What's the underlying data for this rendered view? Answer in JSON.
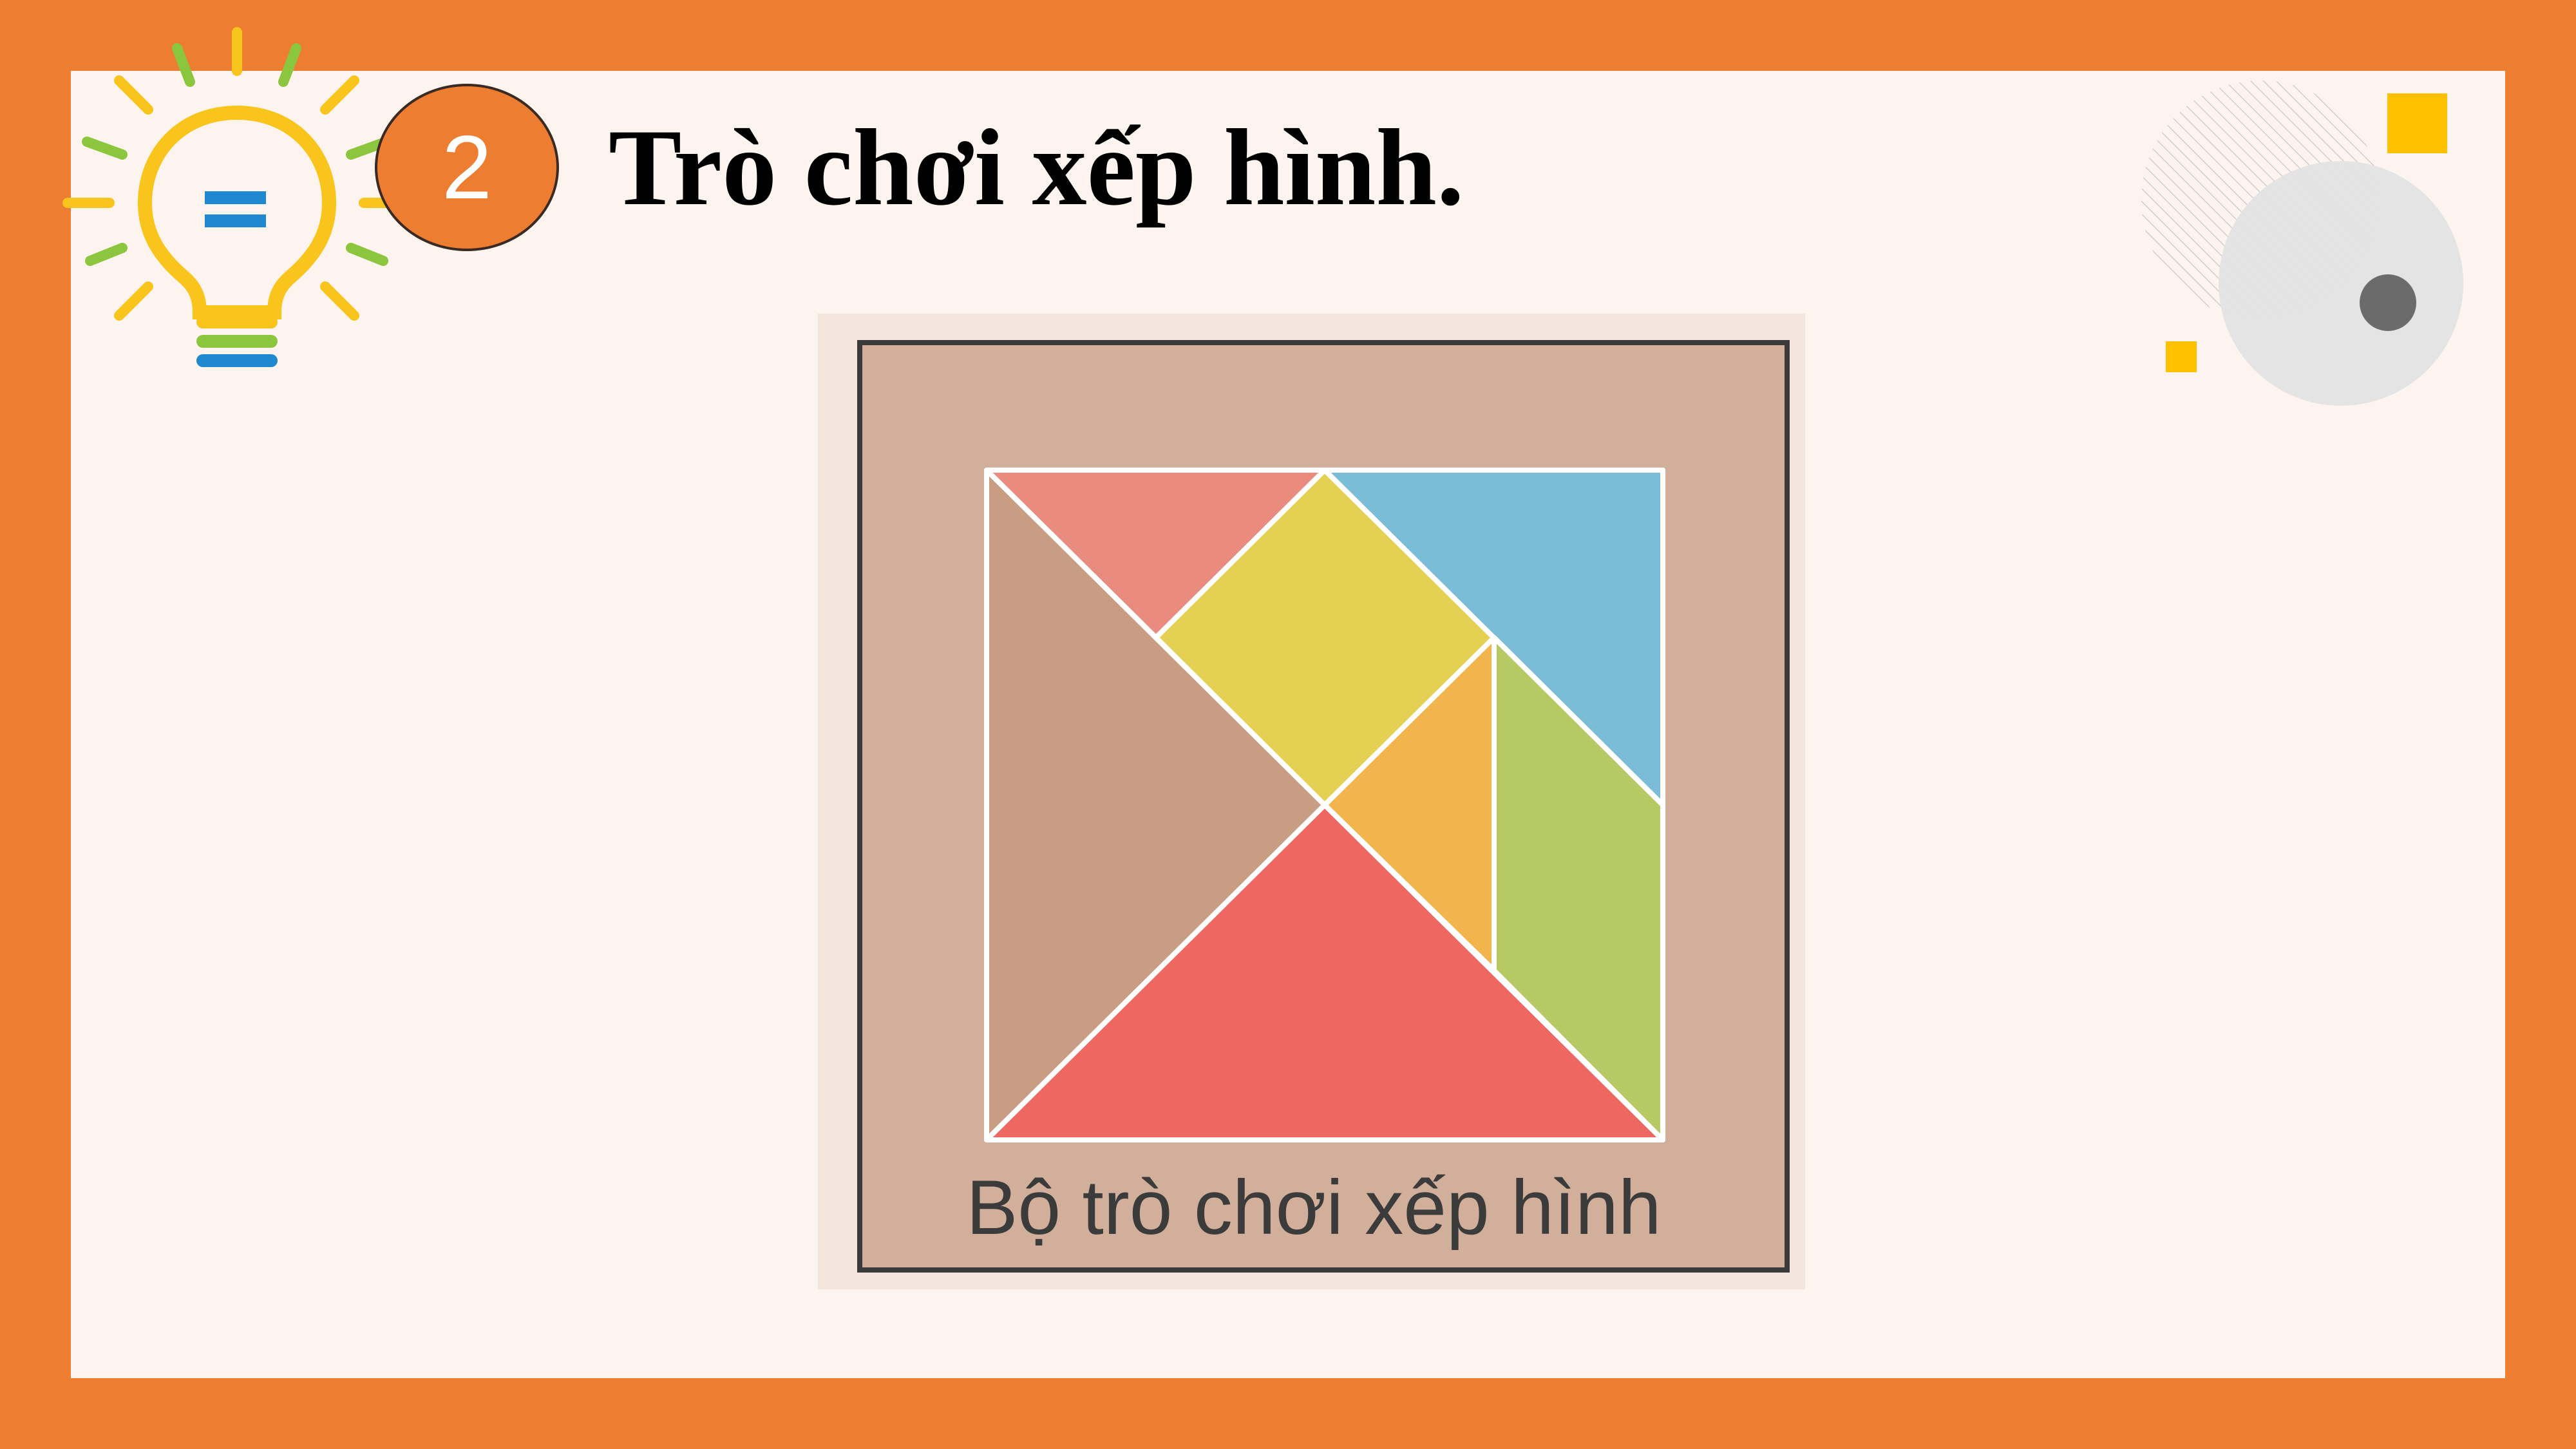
{
  "slide": {
    "number": "2",
    "title": "Trò chơi xếp hình."
  },
  "figure": {
    "caption": "Bộ trò chơi xếp hình",
    "pieces": [
      {
        "name": "small-pink-triangle",
        "color": "#E98B7E"
      },
      {
        "name": "yellow-square",
        "color": "#E4D052"
      },
      {
        "name": "blue-triangle",
        "color": "#7BBCD6"
      },
      {
        "name": "brown-triangle",
        "color": "#C99C84"
      },
      {
        "name": "orange-triangle",
        "color": "#F2B54E"
      },
      {
        "name": "green-parallelogram",
        "color": "#B6C965"
      },
      {
        "name": "red-triangle",
        "color": "#EE6761"
      }
    ]
  },
  "colors": {
    "frame": "#ED7D31",
    "background": "#FDF4EF",
    "board": "#D2AF9B",
    "accent_yellow": "#FFC000",
    "bulb_yellow": "#F9C51C",
    "bulb_green": "#8CC63F",
    "bulb_blue": "#1E88D0"
  },
  "icons": [
    "lightbulb-icon",
    "number-badge",
    "decorative-circles"
  ]
}
